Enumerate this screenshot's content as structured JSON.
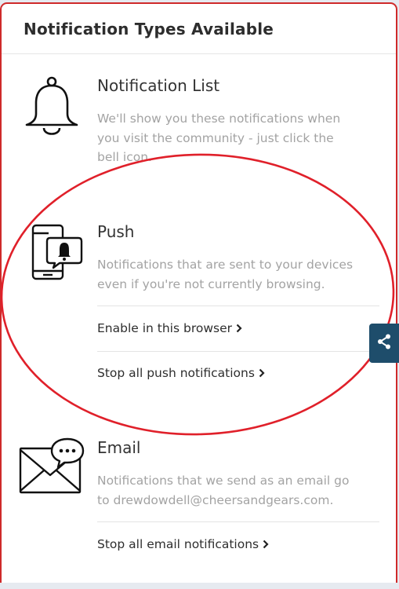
{
  "card": {
    "title": "Notification Types Available"
  },
  "sections": [
    {
      "icon": "bell-icon",
      "title": "Notification List",
      "description_lines": [
        "We'll show you these notifications when",
        "you visit the community - just click the",
        "bell icon."
      ]
    },
    {
      "icon": "mobile-notification-icon",
      "title": "Push",
      "description_lines": [
        "Notifications that are sent to your devices",
        "even if you're not currently browsing."
      ],
      "links": [
        "Enable in this browser",
        "Stop all push notifications"
      ]
    },
    {
      "icon": "email-chat-icon",
      "title": "Email",
      "description_lines": [
        "Notifications that we send as an email go",
        "to drewdowdell@cheersandgears.com."
      ],
      "links": [
        "Stop all email notifications"
      ]
    }
  ],
  "share_tab": {
    "icon": "share-icon"
  },
  "annotation": {
    "color": "#e0202a"
  },
  "colors": {
    "card_border": "#cf2a2a",
    "share_tab": "#1e4d6b",
    "muted_text": "#a3a3a3"
  }
}
